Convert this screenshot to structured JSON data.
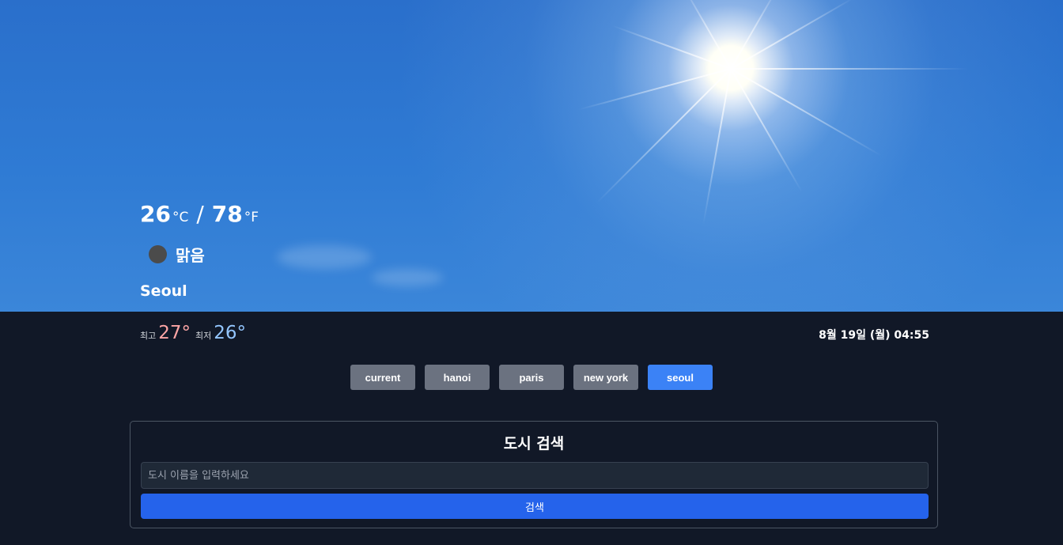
{
  "weather": {
    "temp_c": "26",
    "unit_c": "°C",
    "separator": "/",
    "temp_f": "78",
    "unit_f": "°F",
    "condition_icon": "weather-condition-circle-icon",
    "condition": "맑음",
    "city": "Seoul",
    "high_label": "최고",
    "high": "27°",
    "low_label": "최저",
    "low": "26°",
    "datetime": "8월 19일 (월) 04:55"
  },
  "cities": [
    {
      "label": "current",
      "active": false
    },
    {
      "label": "hanoi",
      "active": false
    },
    {
      "label": "paris",
      "active": false
    },
    {
      "label": "new york",
      "active": false
    },
    {
      "label": "seoul",
      "active": true
    }
  ],
  "search": {
    "title": "도시 검색",
    "placeholder": "도시 이름을 입력하세요",
    "value": "",
    "button_label": "검색"
  },
  "colors": {
    "background": "#111827",
    "button_default": "#6b7280",
    "button_active": "#3b82f6",
    "search_button": "#2563eb",
    "high_temp": "#fca5a5",
    "low_temp": "#93c5fd"
  }
}
